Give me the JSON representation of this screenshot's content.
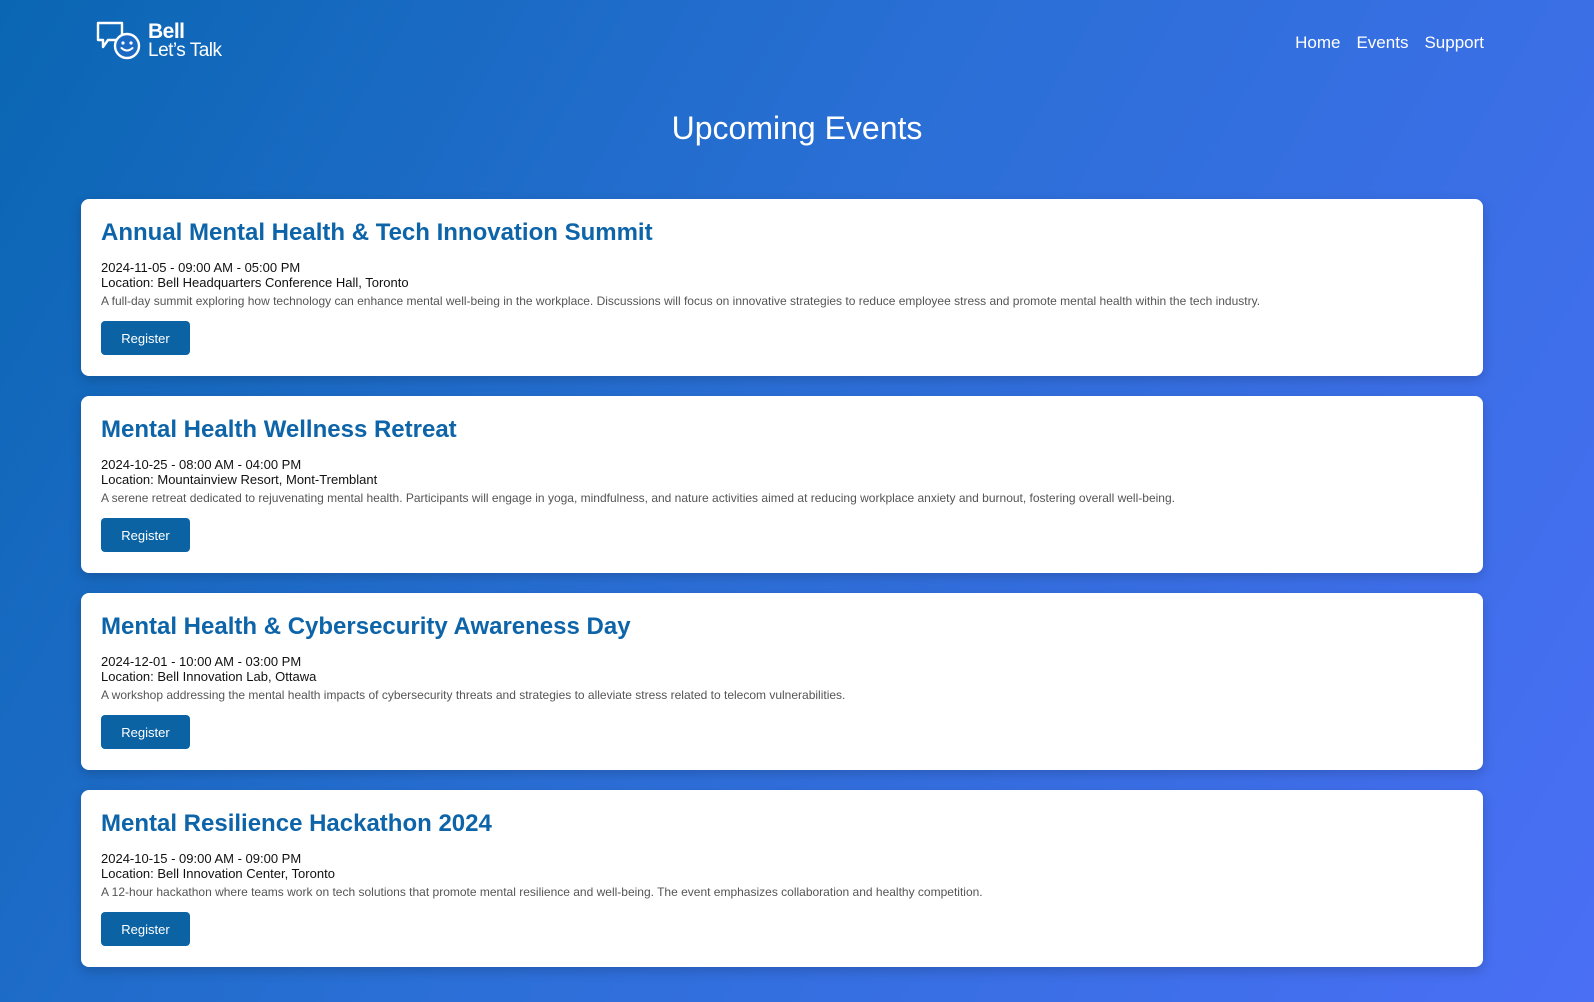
{
  "header": {
    "logo": {
      "brand": "Bell",
      "sub": "Let’s Talk",
      "icon": "chat-face-icon"
    },
    "nav": [
      {
        "label": "Home"
      },
      {
        "label": "Events"
      },
      {
        "label": "Support"
      }
    ]
  },
  "main": {
    "title": "Upcoming Events",
    "events": [
      {
        "title": "Annual Mental Health & Tech Innovation Summit",
        "datetime": "2024-11-05 - 09:00 AM - 05:00 PM",
        "location": "Location: Bell Headquarters Conference Hall, Toronto",
        "description": "A full-day summit exploring how technology can enhance mental well-being in the workplace. Discussions will focus on innovative strategies to reduce employee stress and promote mental health within the tech industry.",
        "button": "Register"
      },
      {
        "title": "Mental Health Wellness Retreat",
        "datetime": "2024-10-25 - 08:00 AM - 04:00 PM",
        "location": "Location: Mountainview Resort, Mont-Tremblant",
        "description": "A serene retreat dedicated to rejuvenating mental health. Participants will engage in yoga, mindfulness, and nature activities aimed at reducing workplace anxiety and burnout, fostering overall well-being.",
        "button": "Register"
      },
      {
        "title": "Mental Health & Cybersecurity Awareness Day",
        "datetime": "2024-12-01 - 10:00 AM - 03:00 PM",
        "location": "Location: Bell Innovation Lab, Ottawa",
        "description": "A workshop addressing the mental health impacts of cybersecurity threats and strategies to alleviate stress related to telecom vulnerabilities.",
        "button": "Register"
      },
      {
        "title": "Mental Resilience Hackathon 2024",
        "datetime": "2024-10-15 - 09:00 AM - 09:00 PM",
        "location": "Location: Bell Innovation Center, Toronto",
        "description": "A 12-hour hackathon where teams work on tech solutions that promote mental resilience and well-being. The event emphasizes collaboration and healthy competition.",
        "button": "Register"
      }
    ]
  },
  "colors": {
    "background_start": "#0a66b2",
    "background_end": "#4a6ff5",
    "title_blue": "#0d64a8",
    "button_blue": "#0b63a4"
  }
}
